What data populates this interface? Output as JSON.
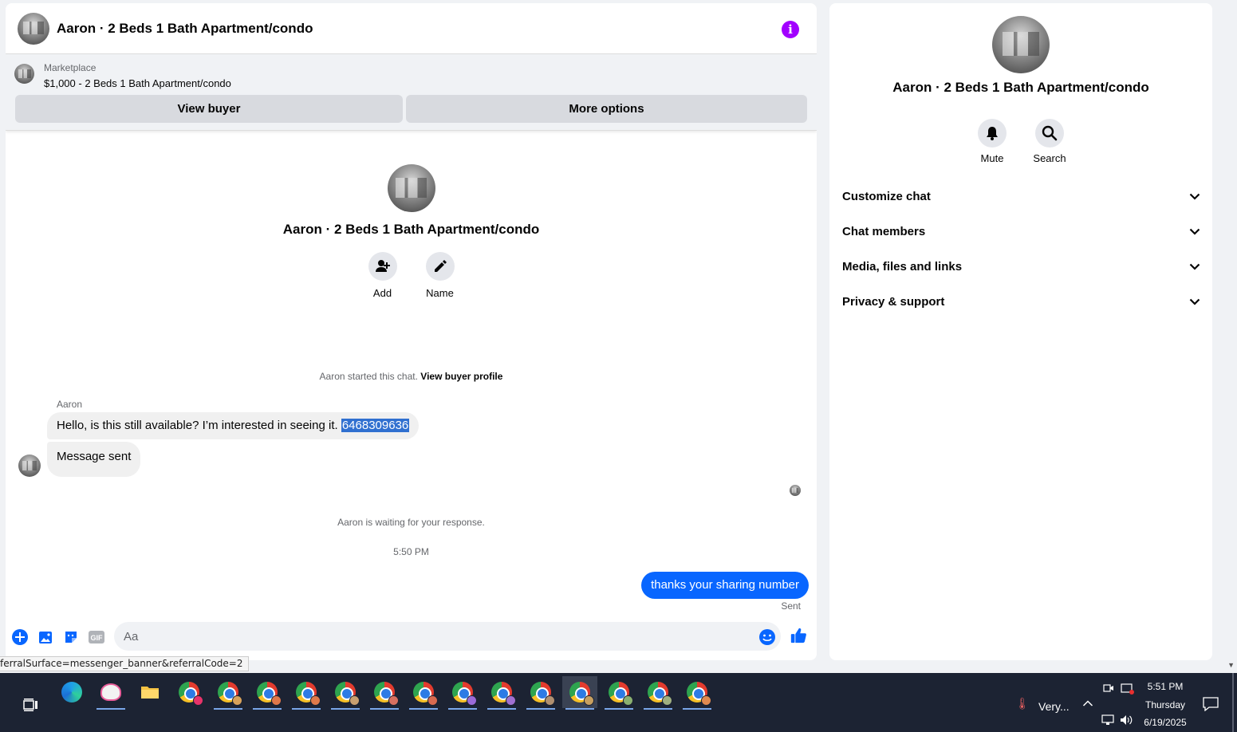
{
  "chat": {
    "title": "Aaron · 2 Beds 1 Bath Apartment/condo",
    "info_icon": "i",
    "banner": {
      "label": "Marketplace",
      "listing": "$1,000 - 2 Beds 1 Bath Apartment/condo",
      "view_buyer": "View buyer",
      "more_options": "More options"
    },
    "intro": {
      "title": "Aaron · 2 Beds 1 Bath Apartment/condo",
      "add_label": "Add",
      "name_label": "Name"
    },
    "started_text": "Aaron started this chat.",
    "view_profile": "View buyer profile",
    "sender": "Aaron",
    "message_1": "Hello, is this still available? I’m interested in seeing it.",
    "message_1_number": "6468309636",
    "message_2": "Message sent",
    "waiting_text": "Aaron is waiting for your response.",
    "timestamp": "5:50 PM",
    "outgoing": "thanks your sharing number",
    "sent_label": "Sent",
    "composer_placeholder": "Aa"
  },
  "status_url": "ferralSurface=messenger_banner&referralCode=2",
  "side": {
    "title": "Aaron · 2 Beds 1 Bath Apartment/condo",
    "mute": "Mute",
    "search": "Search",
    "sections": [
      "Customize chat",
      "Chat members",
      "Media, files and links",
      "Privacy & support"
    ]
  },
  "taskbar": {
    "weather": "Very...",
    "time": "5:51 PM",
    "day": "Thursday",
    "date": "6/19/2025"
  },
  "colors": {
    "accent": "#0866ff",
    "info": "#a200ff",
    "highlight": "#3070d0"
  }
}
